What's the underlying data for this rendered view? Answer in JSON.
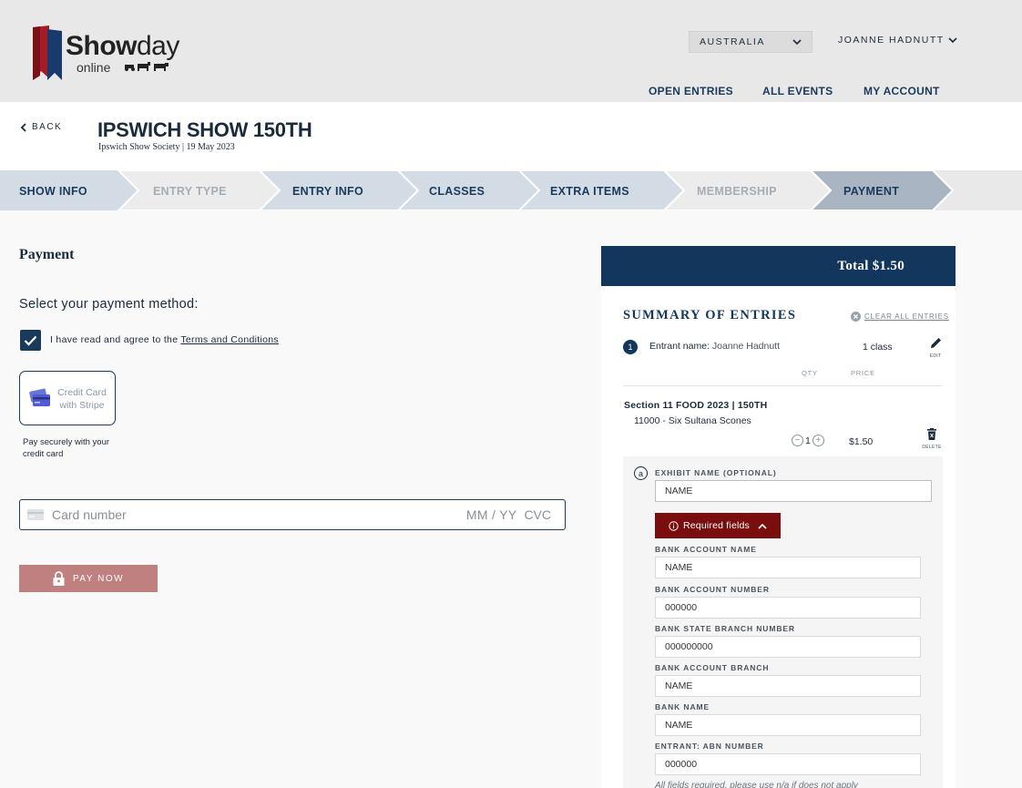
{
  "header": {
    "logo": {
      "brand_bold": "Show",
      "brand_light": "day",
      "sub": "online",
      "animals": "‘🐴🐄"
    },
    "country": "AUSTRALIA",
    "user": "JOANNE HADNUTT",
    "nav": [
      "OPEN ENTRIES",
      "ALL EVENTS",
      "MY ACCOUNT"
    ]
  },
  "titlebar": {
    "back": "BACK",
    "title": "IPSWICH SHOW 150TH",
    "subtitle": "Ipswich Show Society | 19 May 2023"
  },
  "steps": [
    {
      "label": "SHOW INFO",
      "state": "active"
    },
    {
      "label": "ENTRY TYPE",
      "state": "inactive"
    },
    {
      "label": "ENTRY INFO",
      "state": "active"
    },
    {
      "label": "CLASSES",
      "state": "active"
    },
    {
      "label": "EXTRA ITEMS",
      "state": "active"
    },
    {
      "label": "MEMBERSHIP",
      "state": "inactive"
    },
    {
      "label": "PAYMENT",
      "state": "current"
    }
  ],
  "payment": {
    "heading": "Payment",
    "select_method": "Select your payment method:",
    "terms_prefix": "I have read and agree to the ",
    "terms_link": "Terms and Conditions",
    "stripe_label": "Credit Card with Stripe",
    "pay_secure": "Pay securely with your credit card",
    "card_placeholder": "Card number",
    "card_exp": "MM / YY",
    "card_cvc": "CVC",
    "pay_button": "PAY NOW"
  },
  "summary": {
    "total": "Total $1.50",
    "title": "SUMMARY OF ENTRIES",
    "clear_all": "CLEAR ALL ENTRIES",
    "entrant_number": "1",
    "entrant_label": "Entrant name: ",
    "entrant_name": "Joanne Hadnutt",
    "class_count": "1 class",
    "edit_label": "EDIT",
    "col_qty": "QTY",
    "col_price": "PRICE",
    "section": "Section 11 FOOD 2023 | 150TH",
    "class_name": "11000 - Six Sultana Scones",
    "qty": "1",
    "price": "$1.50",
    "delete_label": "DELETE",
    "exhibit": {
      "letter": "a",
      "exhibit_name_label": "EXHIBIT NAME (OPTIONAL)",
      "exhibit_name_value": "NAME",
      "required_fields": "Required fields",
      "fields": [
        {
          "label": "BANK ACCOUNT NAME",
          "value": "NAME"
        },
        {
          "label": "BANK ACCOUNT NUMBER",
          "value": "000000"
        },
        {
          "label": "BANK STATE BRANCH NUMBER",
          "value": "000000000"
        },
        {
          "label": "BANK ACCOUNT BRANCH",
          "value": "NAME"
        },
        {
          "label": "BANK NAME",
          "value": "NAME"
        },
        {
          "label": "ENTRANT: ABN NUMBER",
          "value": "000000"
        }
      ],
      "footnote": "All fields required, please use n/a if does not apply"
    }
  },
  "colors": {
    "navy": "#13365c",
    "step_active_bg": "#d3dbe5",
    "step_current_bg": "#a9b5c3",
    "pay_button": "#c08080",
    "required": "#7a0d0d"
  }
}
